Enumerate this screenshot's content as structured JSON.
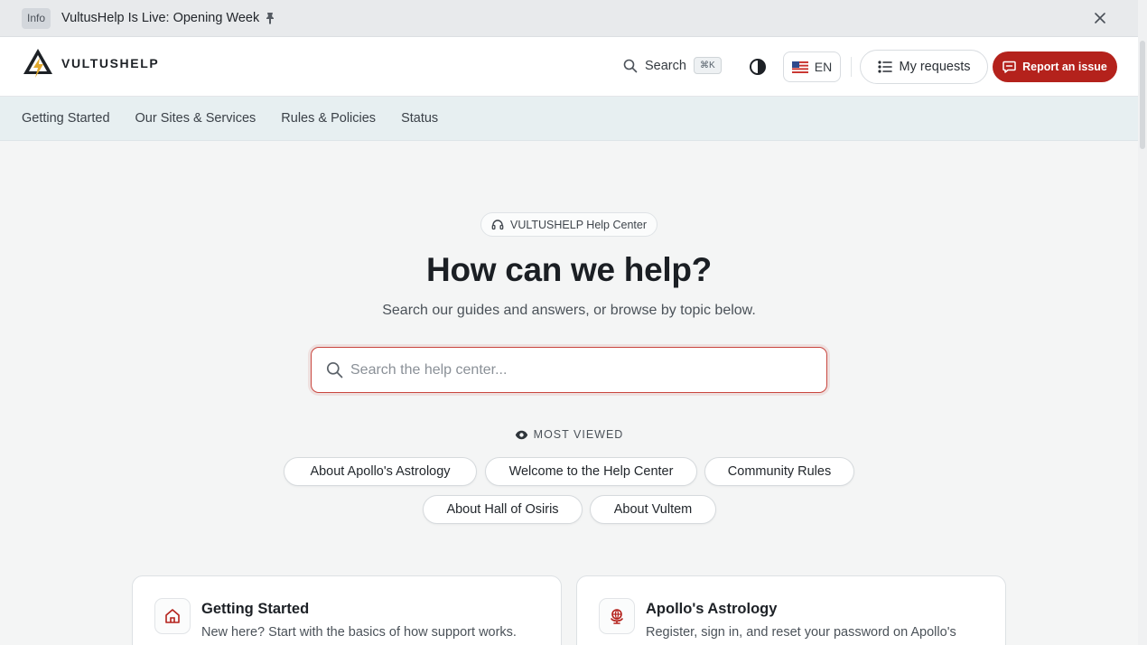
{
  "announcement": {
    "badge": "Info",
    "message": "VultusHelp Is Live: Opening Week",
    "pin_icon": "pin-icon",
    "close_icon": "close-icon"
  },
  "header": {
    "brand": "VULTUSHELP",
    "search_label": "Search",
    "search_shortcut": "⌘K",
    "language": "EN",
    "my_requests_label": "My requests",
    "report_label": "Report an issue",
    "accent_color": "#b4221c"
  },
  "nav": {
    "items": [
      "Getting Started",
      "Our Sites & Services",
      "Rules & Policies",
      "Status"
    ]
  },
  "hero": {
    "pill_label": "VULTUSHELP Help Center",
    "title": "How can we help?",
    "subtitle": "Search our guides and answers, or browse by topic below.",
    "search_placeholder": "Search the help center...",
    "most_viewed_label": "MOST VIEWED",
    "chips": [
      "About Apollo's Astrology",
      "Welcome to the Help Center",
      "Community Rules",
      "About Hall of Osiris",
      "About Vultem"
    ]
  },
  "cards": [
    {
      "title": "Getting Started",
      "description": "New here? Start with the basics of how support works.",
      "icon": "home-icon"
    },
    {
      "title": "Apollo's Astrology",
      "description": "Register, sign in, and reset your password on Apollo's",
      "icon": "globe-icon"
    }
  ]
}
